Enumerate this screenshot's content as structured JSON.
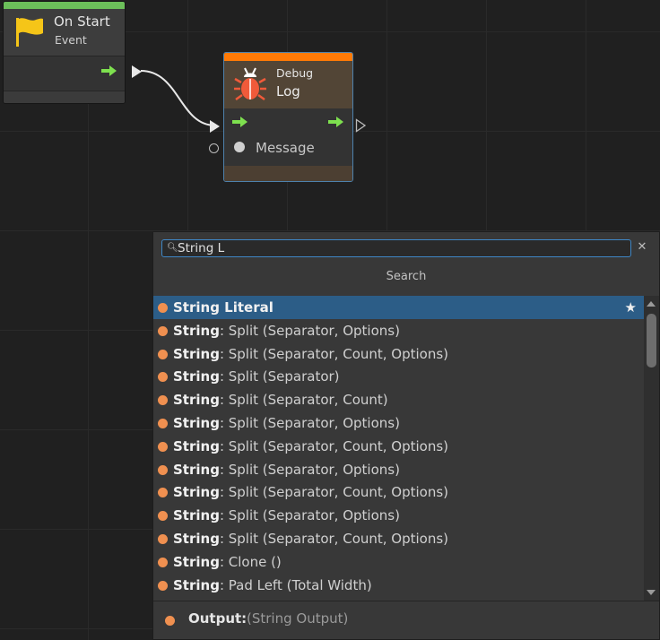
{
  "nodes": {
    "on_start": {
      "title": "On Start",
      "subtitle": "Event",
      "icon": "flag-icon",
      "accent_color": "#6cbf5a"
    },
    "debug_log": {
      "category": "Debug",
      "title": "Log",
      "icon": "bug-icon",
      "accent_color": "#ff7a06",
      "input_port_label": "Message"
    }
  },
  "search": {
    "query": "String L",
    "header": "Search",
    "results": [
      {
        "bold": "String Literal",
        "rest": "",
        "selected": true,
        "favorite": true
      },
      {
        "bold": "String",
        "rest": ": Split (Separator, Options)"
      },
      {
        "bold": "String",
        "rest": ": Split (Separator, Count, Options)"
      },
      {
        "bold": "String",
        "rest": ": Split (Separator)"
      },
      {
        "bold": "String",
        "rest": ": Split (Separator, Count)"
      },
      {
        "bold": "String",
        "rest": ": Split (Separator, Options)"
      },
      {
        "bold": "String",
        "rest": ": Split (Separator, Count, Options)"
      },
      {
        "bold": "String",
        "rest": ": Split (Separator, Options)"
      },
      {
        "bold": "String",
        "rest": ": Split (Separator, Count, Options)"
      },
      {
        "bold": "String",
        "rest": ": Split (Separator, Options)"
      },
      {
        "bold": "String",
        "rest": ": Split (Separator, Count, Options)"
      },
      {
        "bold": "String",
        "rest": ": Clone ()"
      },
      {
        "bold": "String",
        "rest": ": Pad Left (Total Width)"
      }
    ],
    "output_label": "Output:",
    "output_value": "(String Output)",
    "selection_color": "#2c5d87",
    "type_dot_color": "#f09050"
  }
}
